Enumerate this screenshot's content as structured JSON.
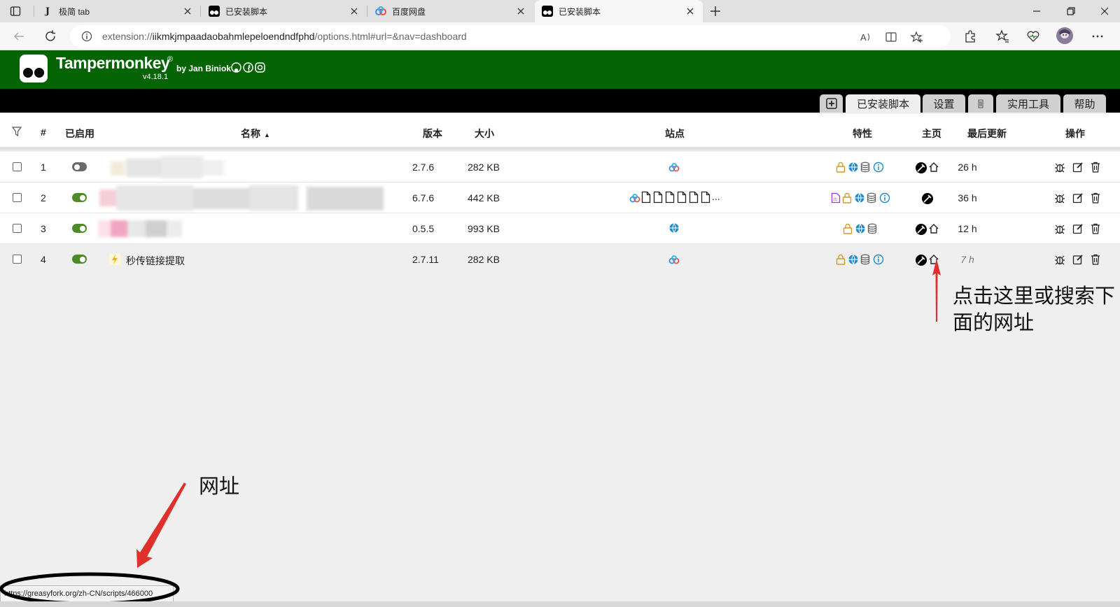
{
  "browser": {
    "tabs": [
      {
        "label": "极简 tab",
        "icon": "j-logo-icon",
        "active": false
      },
      {
        "label": "已安装脚本",
        "icon": "tampermonkey-icon",
        "active": false
      },
      {
        "label": "百度网盘",
        "icon": "baidu-netdisk-icon",
        "active": false
      },
      {
        "label": "已安装脚本",
        "icon": "tampermonkey-icon",
        "active": true
      }
    ],
    "address": {
      "scheme": "extension://",
      "host": "iikmkjmpaadaobahmlepeloendndfphd",
      "path": "/options.html#url=&nav=dashboard"
    }
  },
  "header": {
    "title": "Tampermonkey",
    "reg": "®",
    "by": "by Jan Biniok",
    "version": "v4.18.1",
    "brand_color": "#046404"
  },
  "tm_tabs": {
    "installed": "已安装脚本",
    "settings": "设置",
    "utilities": "实用工具",
    "help": "帮助"
  },
  "table": {
    "headers": {
      "num": "#",
      "enabled": "已启用",
      "name": "名称",
      "version": "版本",
      "size": "大小",
      "sites": "站点",
      "features": "特性",
      "homepage": "主页",
      "updated": "最后更新",
      "actions": "操作"
    },
    "rows": [
      {
        "num": "1",
        "enabled": false,
        "name": "",
        "version": "2.7.6",
        "size": "282 KB",
        "updated": "26 h"
      },
      {
        "num": "2",
        "enabled": true,
        "name": "",
        "version": "6.7.6",
        "size": "442 KB",
        "updated": "36 h",
        "sites_more": "..."
      },
      {
        "num": "3",
        "enabled": true,
        "name": "",
        "version": "0.5.5",
        "size": "993 KB",
        "updated": "12 h"
      },
      {
        "num": "4",
        "enabled": true,
        "name": "秒传链接提取",
        "version": "2.7.11",
        "size": "282 KB",
        "updated": "7 h"
      }
    ]
  },
  "annotations": {
    "home_hint": "点击这里或搜索下面的网址",
    "url_label": "网址",
    "arrow_color": "#e0302b"
  },
  "status_bar": {
    "url": "https://greasyfork.org/zh-CN/scripts/466000"
  }
}
